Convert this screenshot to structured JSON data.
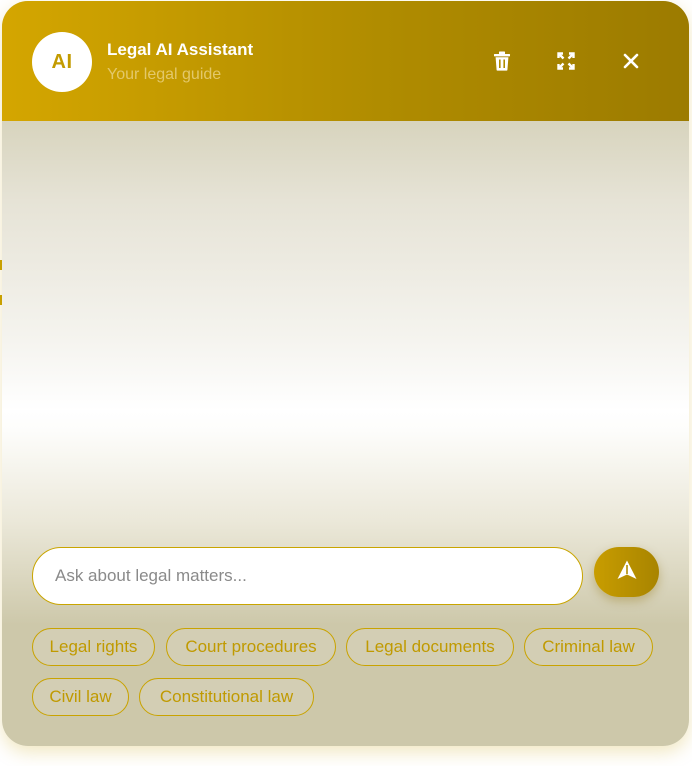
{
  "header": {
    "avatar_text": "AI",
    "title": "Legal AI Assistant",
    "subtitle": "Your legal guide",
    "actions": [
      {
        "icon": "trash-icon",
        "label": "Clear chat"
      },
      {
        "icon": "expand-icon",
        "label": "Expand"
      },
      {
        "icon": "close-icon",
        "label": "Close"
      }
    ]
  },
  "composer": {
    "placeholder": "Ask about legal matters...",
    "value": "",
    "send_icon": "send-icon"
  },
  "suggestions": [
    "Legal rights",
    "Court procedures",
    "Legal documents",
    "Criminal law",
    "Civil law",
    "Constitutional law"
  ],
  "colors": {
    "accent": "#c9a300",
    "header_start": "#d4a600",
    "header_end": "#9c7b00",
    "chip_text": "#c09a00"
  }
}
